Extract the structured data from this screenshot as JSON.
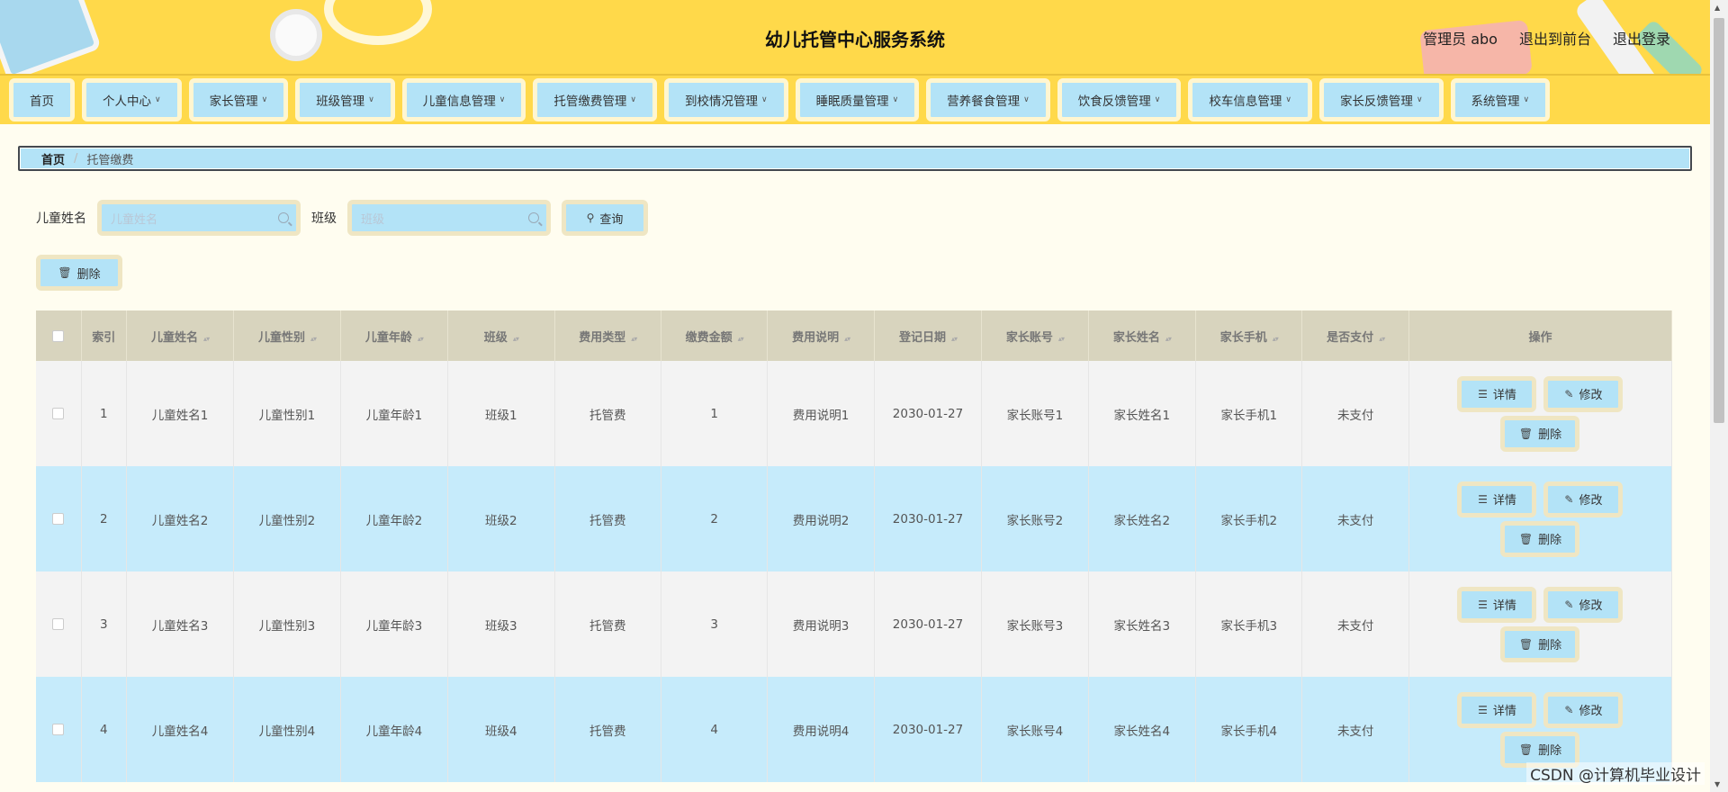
{
  "header": {
    "title": "幼儿托管中心服务系统",
    "admin_label": "管理员 abo",
    "to_front_label": "退出到前台",
    "logout_label": "退出登录"
  },
  "nav": {
    "items": [
      {
        "label": "首页",
        "has_dropdown": false
      },
      {
        "label": "个人中心",
        "has_dropdown": true
      },
      {
        "label": "家长管理",
        "has_dropdown": true
      },
      {
        "label": "班级管理",
        "has_dropdown": true
      },
      {
        "label": "儿童信息管理",
        "has_dropdown": true
      },
      {
        "label": "托管缴费管理",
        "has_dropdown": true
      },
      {
        "label": "到校情况管理",
        "has_dropdown": true
      },
      {
        "label": "睡眠质量管理",
        "has_dropdown": true
      },
      {
        "label": "营养餐食管理",
        "has_dropdown": true
      },
      {
        "label": "饮食反馈管理",
        "has_dropdown": true
      },
      {
        "label": "校车信息管理",
        "has_dropdown": true
      },
      {
        "label": "家长反馈管理",
        "has_dropdown": true
      },
      {
        "label": "系统管理",
        "has_dropdown": true
      }
    ]
  },
  "breadcrumb": {
    "home": "首页",
    "separator": "/",
    "current": "托管缴费"
  },
  "search": {
    "name_label": "儿童姓名",
    "name_placeholder": "儿童姓名",
    "class_label": "班级",
    "class_placeholder": "班级",
    "query_label": "查询"
  },
  "toolbar": {
    "delete_label": "删除"
  },
  "table": {
    "columns": [
      "索引",
      "儿童姓名",
      "儿童性别",
      "儿童年龄",
      "班级",
      "费用类型",
      "缴费金额",
      "费用说明",
      "登记日期",
      "家长账号",
      "家长姓名",
      "家长手机",
      "是否支付",
      "操作"
    ],
    "rows": [
      [
        "1",
        "儿童姓名1",
        "儿童性别1",
        "儿童年龄1",
        "班级1",
        "托管费",
        "1",
        "费用说明1",
        "2030-01-27",
        "家长账号1",
        "家长姓名1",
        "家长手机1",
        "未支付"
      ],
      [
        "2",
        "儿童姓名2",
        "儿童性别2",
        "儿童年龄2",
        "班级2",
        "托管费",
        "2",
        "费用说明2",
        "2030-01-27",
        "家长账号2",
        "家长姓名2",
        "家长手机2",
        "未支付"
      ],
      [
        "3",
        "儿童姓名3",
        "儿童性别3",
        "儿童年龄3",
        "班级3",
        "托管费",
        "3",
        "费用说明3",
        "2030-01-27",
        "家长账号3",
        "家长姓名3",
        "家长手机3",
        "未支付"
      ],
      [
        "4",
        "儿童姓名4",
        "儿童性别4",
        "儿童年龄4",
        "班级4",
        "托管费",
        "4",
        "费用说明4",
        "2030-01-27",
        "家长账号4",
        "家长姓名4",
        "家长手机4",
        "未支付"
      ]
    ],
    "actions": {
      "detail": "详情",
      "edit": "修改",
      "delete": "删除"
    }
  },
  "watermark": "CSDN @计算机毕业设计",
  "icons": {
    "search": "search-icon",
    "trash": "trash-icon",
    "detail": "document-icon",
    "edit": "edit-icon",
    "chevron": "chevron-down-icon"
  },
  "colors": {
    "header_bg": "#ffd94a",
    "button_bg": "#b3e3f7",
    "button_border": "#efe6c3",
    "row_alt": "#c6ebfb",
    "table_head": "#d8d4be",
    "page_bg": "#fffdf0"
  }
}
